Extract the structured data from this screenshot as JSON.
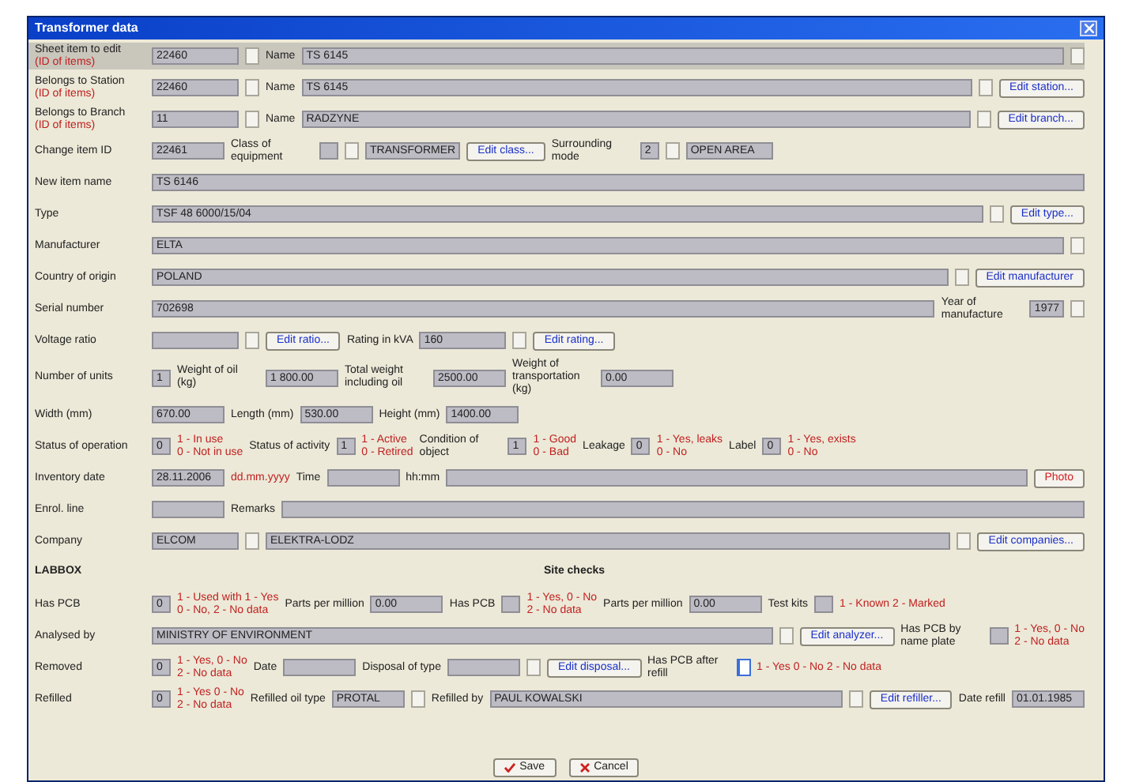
{
  "window": {
    "title": "Transformer data"
  },
  "rows": [
    {
      "highlight": true,
      "items": [
        {
          "kind": "label",
          "text": "Sheet item to edit",
          "note": "(ID of items)"
        },
        {
          "kind": "field",
          "value": "22460"
        },
        {
          "kind": "combo"
        },
        {
          "kind": "label",
          "text": "Name"
        },
        {
          "kind": "wide",
          "value": "TS 6145"
        },
        {
          "kind": "combo"
        }
      ]
    },
    {
      "highlight": false,
      "items": [
        {
          "kind": "label",
          "text": "Belongs to Station",
          "note": "(ID of items)"
        },
        {
          "kind": "field",
          "value": "22460"
        },
        {
          "kind": "combo"
        },
        {
          "kind": "label",
          "text": "Name"
        },
        {
          "kind": "wide",
          "value": "TS 6145"
        },
        {
          "kind": "combo"
        },
        {
          "kind": "button",
          "text": "Edit station..."
        }
      ]
    },
    {
      "highlight": false,
      "items": [
        {
          "kind": "label",
          "text": "Belongs to Branch",
          "note": "(ID of items)"
        },
        {
          "kind": "field",
          "value": "11"
        },
        {
          "kind": "combo"
        },
        {
          "kind": "label",
          "text": "Name"
        },
        {
          "kind": "wide",
          "value": "RADZYNE"
        },
        {
          "kind": "combo"
        },
        {
          "kind": "button",
          "text": "Edit branch..."
        }
      ]
    },
    {
      "highlight": false,
      "items": [
        {
          "kind": "label",
          "text": "Change item ID"
        },
        {
          "kind": "short",
          "value": "22461"
        },
        {
          "kind": "label",
          "text": "Class of equipment"
        },
        {
          "kind": "code",
          "value": ""
        },
        {
          "kind": "combo"
        },
        {
          "kind": "short",
          "value": "TRANSFORMER"
        },
        {
          "kind": "button",
          "text": "Edit class..."
        },
        {
          "kind": "label",
          "text": "Surrounding mode"
        },
        {
          "kind": "code",
          "value": "2"
        },
        {
          "kind": "combo"
        },
        {
          "kind": "field",
          "value": "OPEN AREA"
        }
      ]
    },
    {
      "highlight": false,
      "items": [
        {
          "kind": "label",
          "text": "New item name"
        },
        {
          "kind": "wide",
          "value": "TS 6146"
        }
      ]
    },
    {
      "highlight": false,
      "items": [
        {
          "kind": "label",
          "text": "Type"
        },
        {
          "kind": "wide",
          "value": "TSF 48 6000/15/04"
        },
        {
          "kind": "combo"
        },
        {
          "kind": "button",
          "text": "Edit type..."
        }
      ]
    },
    {
      "highlight": false,
      "items": [
        {
          "kind": "label",
          "text": "Manufacturer"
        },
        {
          "kind": "wide",
          "value": "ELTA"
        },
        {
          "kind": "combo"
        }
      ]
    },
    {
      "highlight": false,
      "items": [
        {
          "kind": "label",
          "text": "Country of origin"
        },
        {
          "kind": "wide",
          "value": "POLAND"
        },
        {
          "kind": "combo"
        },
        {
          "kind": "button",
          "text": "Edit manufacturer"
        }
      ]
    },
    {
      "highlight": false,
      "items": [
        {
          "kind": "label",
          "text": "Serial number"
        },
        {
          "kind": "wide",
          "value": "702698"
        },
        {
          "kind": "label",
          "text": "Year of manufacture"
        },
        {
          "kind": "code",
          "value": "1977"
        },
        {
          "kind": "combo"
        }
      ]
    },
    {
      "highlight": false,
      "items": [
        {
          "kind": "label",
          "text": "Voltage ratio"
        },
        {
          "kind": "field",
          "value": ""
        },
        {
          "kind": "combo"
        },
        {
          "kind": "button",
          "text": "Edit ratio..."
        },
        {
          "kind": "label",
          "text": "Rating in kVA"
        },
        {
          "kind": "field",
          "value": "160"
        },
        {
          "kind": "combo"
        },
        {
          "kind": "button",
          "text": "Edit rating..."
        }
      ]
    },
    {
      "highlight": false,
      "items": [
        {
          "kind": "label",
          "text": "Number of units"
        },
        {
          "kind": "code",
          "value": "1"
        },
        {
          "kind": "label",
          "text": "Weight of oil (kg)"
        },
        {
          "kind": "short",
          "value": "1 800.00"
        },
        {
          "kind": "label",
          "text": "Total weight including oil"
        },
        {
          "kind": "short",
          "value": "2500.00"
        },
        {
          "kind": "label",
          "text": "Weight of transportation (kg)"
        },
        {
          "kind": "short",
          "value": "0.00"
        }
      ]
    },
    {
      "highlight": false,
      "items": [
        {
          "kind": "label",
          "text": "Width (mm)"
        },
        {
          "kind": "short",
          "value": "670.00"
        },
        {
          "kind": "label",
          "text": "Length (mm)"
        },
        {
          "kind": "short",
          "value": "530.00"
        },
        {
          "kind": "label",
          "text": "Height (mm)"
        },
        {
          "kind": "short",
          "value": "1400.00"
        }
      ]
    },
    {
      "highlight": false,
      "items": [
        {
          "kind": "label",
          "text": "Status of operation"
        },
        {
          "kind": "code",
          "value": "0"
        },
        {
          "kind": "note",
          "text": "1 - In use\n0 - Not in use"
        },
        {
          "kind": "label",
          "text": "Status of activity"
        },
        {
          "kind": "code",
          "value": "1"
        },
        {
          "kind": "note",
          "text": "1 - Active\n0 - Retired"
        },
        {
          "kind": "label",
          "text": "Condition of object"
        },
        {
          "kind": "code",
          "value": "1"
        },
        {
          "kind": "note",
          "text": "1 - Good\n0 - Bad"
        },
        {
          "kind": "label",
          "text": "Leakage"
        },
        {
          "kind": "code",
          "value": "0"
        },
        {
          "kind": "note",
          "text": "1 - Yes, leaks\n0 - No"
        },
        {
          "kind": "label",
          "text": "Label"
        },
        {
          "kind": "code",
          "value": "0"
        },
        {
          "kind": "note",
          "text": "1 - Yes, exists\n0 - No"
        }
      ]
    },
    {
      "highlight": false,
      "items": [
        {
          "kind": "label",
          "text": "Inventory date"
        },
        {
          "kind": "short",
          "value": "28.11.2006"
        },
        {
          "kind": "note",
          "text": "dd.mm.yyyy"
        },
        {
          "kind": "label",
          "text": "Time"
        },
        {
          "kind": "short",
          "value": ""
        },
        {
          "kind": "label",
          "text": "hh:mm"
        },
        {
          "kind": "wide",
          "value": ""
        },
        {
          "kind": "alert_button",
          "text": "Photo"
        }
      ]
    },
    {
      "highlight": false,
      "items": [
        {
          "kind": "label",
          "text": "Enrol. line"
        },
        {
          "kind": "short",
          "value": ""
        },
        {
          "kind": "label",
          "text": "Remarks"
        },
        {
          "kind": "wide",
          "value": ""
        }
      ]
    },
    {
      "highlight": false,
      "items": [
        {
          "kind": "label",
          "text": "Company"
        },
        {
          "kind": "field",
          "value": "ELCOM"
        },
        {
          "kind": "combo"
        },
        {
          "kind": "wide",
          "value": "ELEKTRA-LODZ"
        },
        {
          "kind": "combo"
        },
        {
          "kind": "button",
          "text": "Edit companies..."
        }
      ]
    },
    {
      "highlight": false,
      "items": [
        {
          "kind": "heading",
          "text": "LABBOX"
        },
        {
          "kind": "heading",
          "text": "Site checks"
        }
      ]
    },
    {
      "highlight": false,
      "items": [
        {
          "kind": "label",
          "text": "Has PCB"
        },
        {
          "kind": "code",
          "value": "0"
        },
        {
          "kind": "note",
          "text": "1 - Used with 1 - Yes\n0 - No, 2 - No data"
        },
        {
          "kind": "label",
          "text": "Parts per million"
        },
        {
          "kind": "short",
          "value": "0.00"
        },
        {
          "kind": "label",
          "text": "Has PCB"
        },
        {
          "kind": "code",
          "value": ""
        },
        {
          "kind": "note",
          "text": "1 - Yes, 0 - No\n2 - No data"
        },
        {
          "kind": "label",
          "text": "Parts per million"
        },
        {
          "kind": "short",
          "value": "0.00"
        },
        {
          "kind": "label",
          "text": "Test kits"
        },
        {
          "kind": "code",
          "value": ""
        },
        {
          "kind": "note",
          "text": "1 - Known 2 - Marked"
        }
      ]
    },
    {
      "highlight": false,
      "items": [
        {
          "kind": "label",
          "text": "Analysed by"
        },
        {
          "kind": "wide",
          "value": "MINISTRY OF ENVIRONMENT"
        },
        {
          "kind": "combo"
        },
        {
          "kind": "button",
          "text": "Edit analyzer..."
        },
        {
          "kind": "label",
          "text": "Has PCB by name plate"
        },
        {
          "kind": "code",
          "value": ""
        },
        {
          "kind": "note",
          "text": "1 - Yes, 0 - No\n2 - No data"
        }
      ]
    },
    {
      "highlight": false,
      "items": [
        {
          "kind": "label",
          "text": "Removed"
        },
        {
          "kind": "code",
          "value": "0"
        },
        {
          "kind": "note",
          "text": "1 - Yes, 0 - No\n2 - No data"
        },
        {
          "kind": "label",
          "text": "Date"
        },
        {
          "kind": "short",
          "value": ""
        },
        {
          "kind": "label",
          "text": "Disposal of type"
        },
        {
          "kind": "short",
          "value": ""
        },
        {
          "kind": "combo"
        },
        {
          "kind": "button",
          "text": "Edit disposal..."
        },
        {
          "kind": "label",
          "text": "Has PCB after refill"
        },
        {
          "kind": "checkbox",
          "checked": false
        },
        {
          "kind": "note",
          "text": "1 - Yes 0 - No 2 - No data"
        }
      ]
    },
    {
      "highlight": false,
      "items": [
        {
          "kind": "label",
          "text": "Refilled"
        },
        {
          "kind": "code",
          "value": "0"
        },
        {
          "kind": "note",
          "text": "1 - Yes 0 - No\n2 - No data"
        },
        {
          "kind": "label",
          "text": "Refilled oil type"
        },
        {
          "kind": "short",
          "value": "PROTAL"
        },
        {
          "kind": "combo"
        },
        {
          "kind": "label",
          "text": "Refilled by"
        },
        {
          "kind": "wide",
          "value": "PAUL KOWALSKI"
        },
        {
          "kind": "combo"
        },
        {
          "kind": "button",
          "text": "Edit refiller..."
        },
        {
          "kind": "label",
          "text": "Date refill"
        },
        {
          "kind": "short",
          "value": "01.01.1985"
        }
      ]
    }
  ],
  "actions": [
    {
      "kind": "save",
      "text": "Save"
    },
    {
      "kind": "cancel",
      "text": "Cancel"
    }
  ]
}
